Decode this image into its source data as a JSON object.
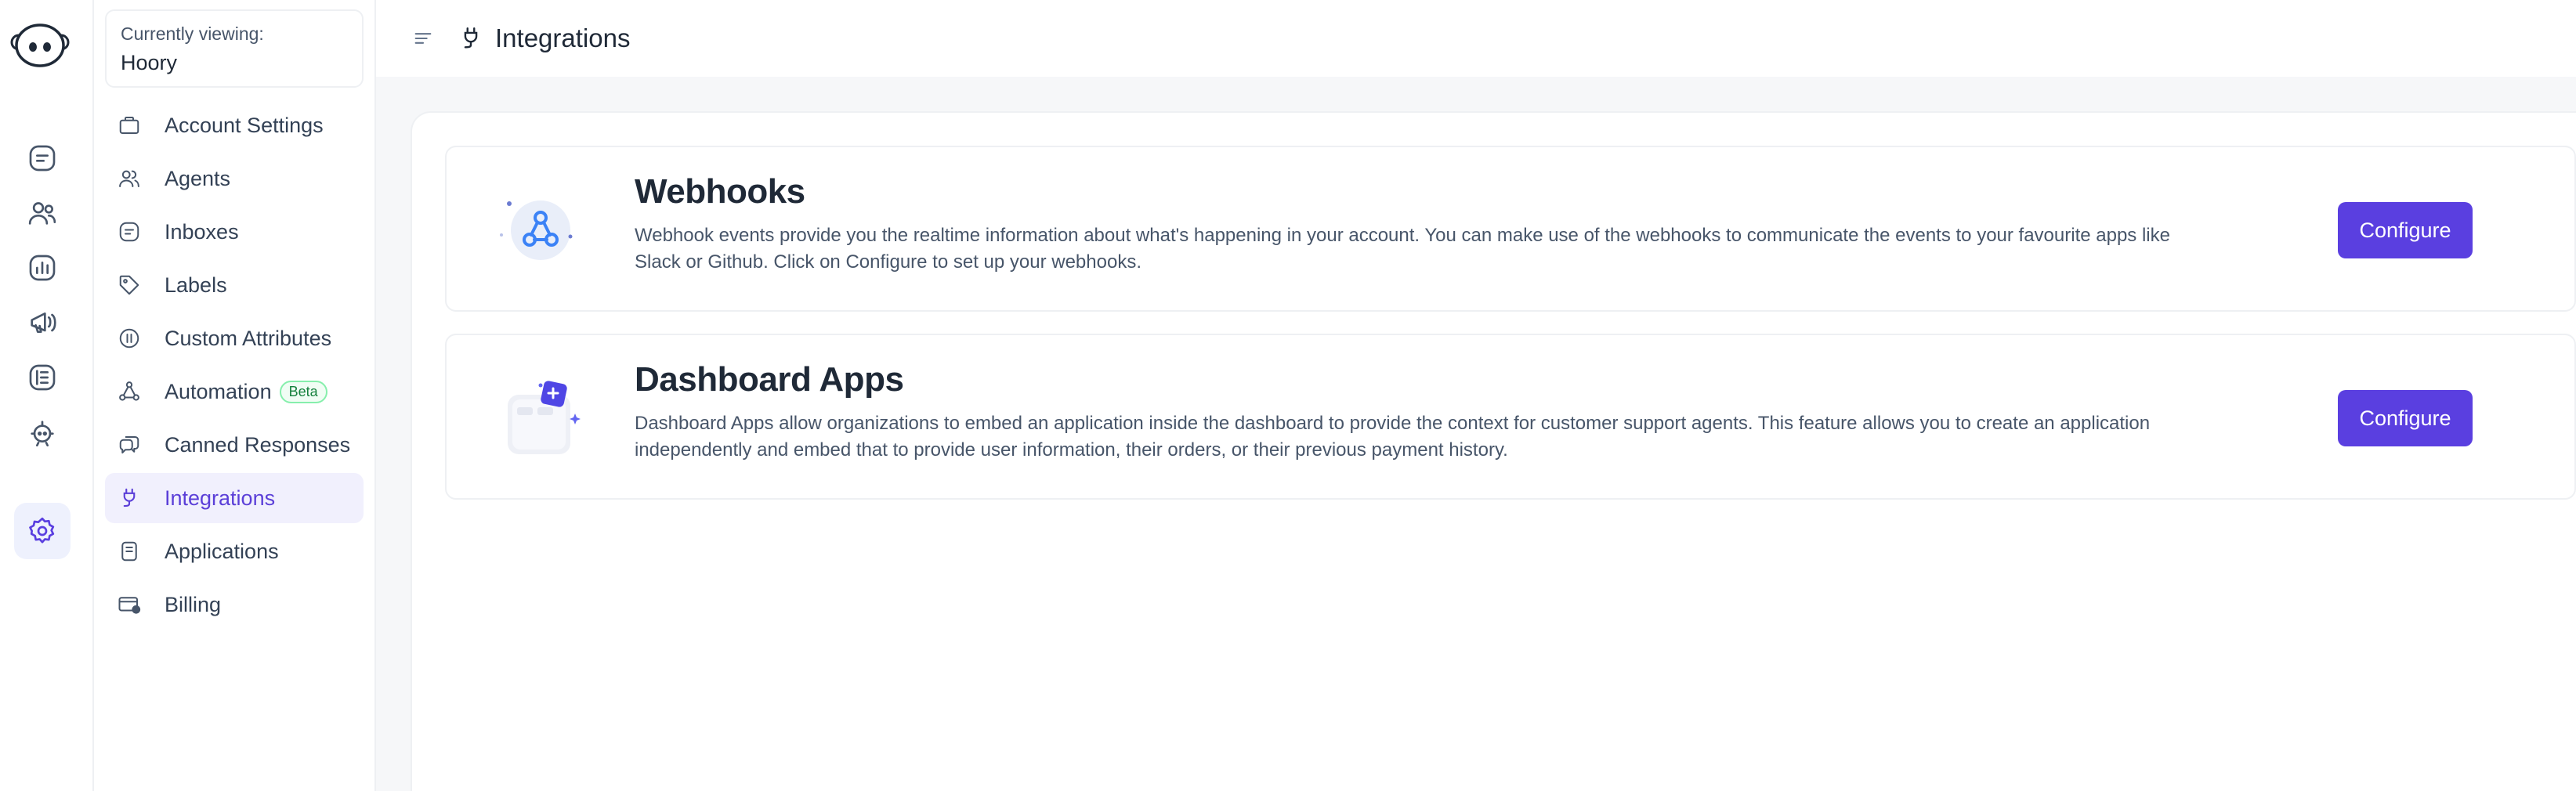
{
  "header": {
    "title": "Integrations"
  },
  "account": {
    "caption": "Currently viewing:",
    "name": "Hoory"
  },
  "sidebar": {
    "items": [
      {
        "label": "Account Settings",
        "icon": "briefcase-icon"
      },
      {
        "label": "Agents",
        "icon": "users-icon"
      },
      {
        "label": "Inboxes",
        "icon": "inbox-icon"
      },
      {
        "label": "Labels",
        "icon": "tag-icon"
      },
      {
        "label": "Custom Attributes",
        "icon": "attributes-icon"
      },
      {
        "label": "Automation",
        "icon": "automation-icon",
        "badge": "Beta"
      },
      {
        "label": "Canned Responses",
        "icon": "chat-bubbles-icon"
      },
      {
        "label": "Integrations",
        "icon": "plug-icon",
        "active": true
      },
      {
        "label": "Applications",
        "icon": "document-icon"
      },
      {
        "label": "Billing",
        "icon": "card-icon"
      }
    ]
  },
  "rail": {
    "icons": [
      "conversations-icon",
      "contacts-icon",
      "reports-icon",
      "campaigns-icon",
      "help-center-icon",
      "bot-icon",
      "settings-icon"
    ],
    "active": "settings-icon"
  },
  "cards": [
    {
      "title": "Webhooks",
      "description": "Webhook events provide you the realtime information about what's happening in your account. You can make use of the webhooks to communicate the events to your favourite apps like Slack or Github. Click on Configure to set up your webhooks.",
      "button": "Configure"
    },
    {
      "title": "Dashboard Apps",
      "description": "Dashboard Apps allow organizations to embed an application inside the dashboard to provide the context for customer support agents. This feature allows you to create an application independently and embed that to provide user information, their orders, or their previous payment history.",
      "button": "Configure"
    }
  ],
  "colors": {
    "accent": "#5a3fe0",
    "active_bg": "#f1f0fd",
    "beta_green": "#15803d"
  }
}
